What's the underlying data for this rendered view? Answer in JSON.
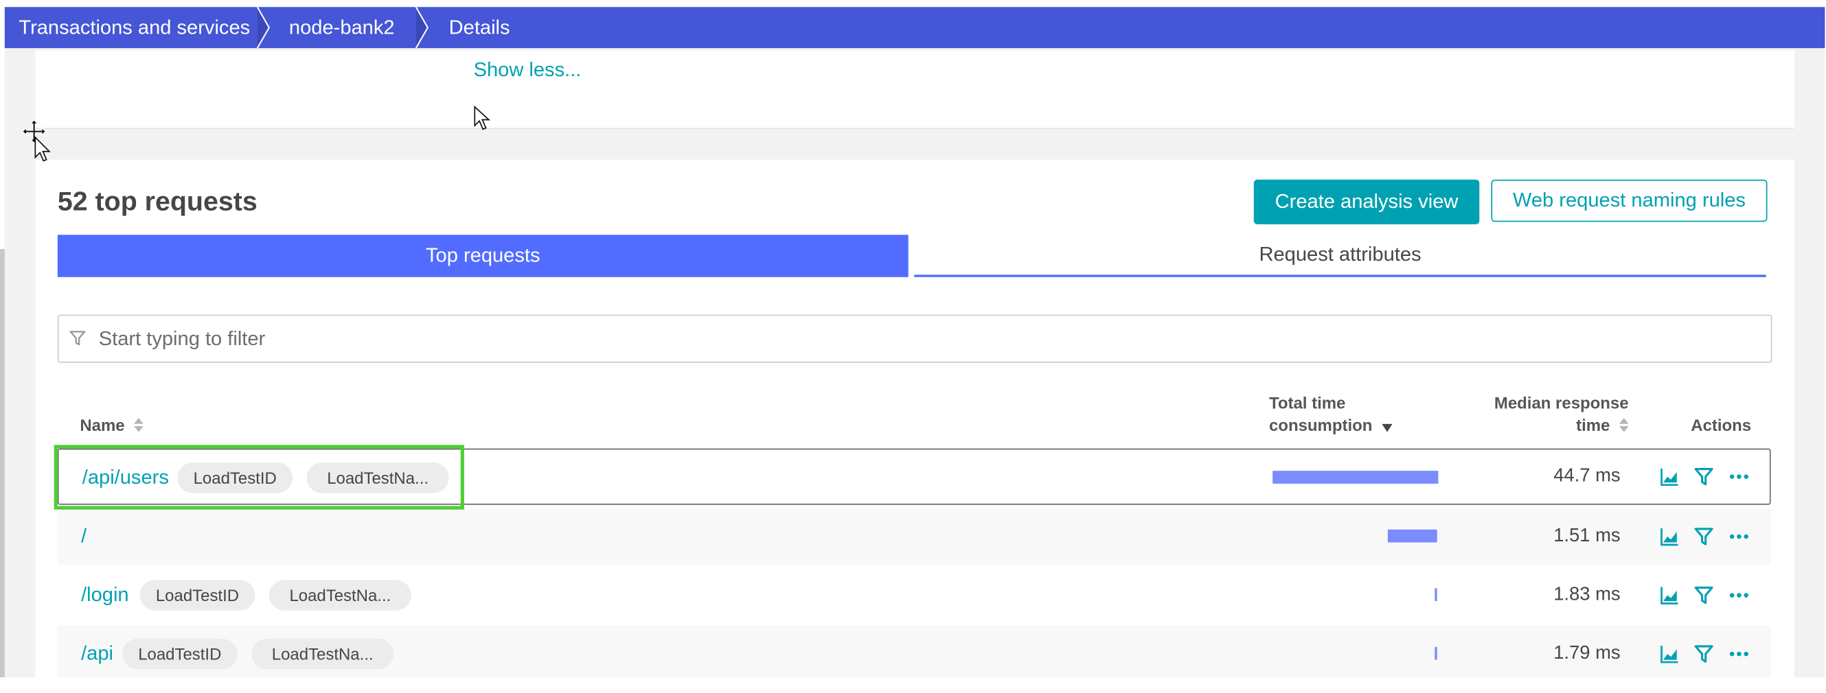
{
  "breadcrumb": {
    "items": [
      {
        "label": "Transactions and services"
      },
      {
        "label": "node-bank2"
      },
      {
        "label": "Details"
      }
    ]
  },
  "top_card": {
    "show_less": "Show less..."
  },
  "requests": {
    "title": "52 top requests",
    "create_analysis_label": "Create analysis view",
    "naming_rules_label": "Web request naming rules",
    "tabs": [
      {
        "label": "Top requests",
        "active": true
      },
      {
        "label": "Request attributes",
        "active": false
      }
    ],
    "filter_placeholder": "Start typing to filter",
    "columns": {
      "name": "Name",
      "total_line1": "Total time",
      "total_line2": "consumption",
      "median_line1": "Median response",
      "median_line2": "time",
      "actions": "Actions"
    },
    "rows": [
      {
        "name": "/api/users",
        "tags": [
          "LoadTestID",
          "LoadTestNa..."
        ],
        "consumption_share": 1.0,
        "median": "44.7 ms",
        "selected": true
      },
      {
        "name": "/",
        "tags": [],
        "consumption_share": 0.3,
        "median": "1.51 ms",
        "selected": false
      },
      {
        "name": "/login",
        "tags": [
          "LoadTestID",
          "LoadTestNa..."
        ],
        "consumption_share": 0.015,
        "median": "1.83 ms",
        "selected": false
      },
      {
        "name": "/api",
        "tags": [
          "LoadTestID",
          "LoadTestNa..."
        ],
        "consumption_share": 0.012,
        "median": "1.79 ms",
        "selected": false
      }
    ]
  },
  "colors": {
    "breadcrumb_bg": "#4556d7",
    "accent_teal": "#00a1b2",
    "tab_active": "#526cff",
    "bar": "#7b8cff",
    "highlight": "#4ccf33"
  },
  "icons": {
    "filter": "filter-icon",
    "sort": "sort-icon",
    "chart": "chart-icon",
    "funnel": "funnel-icon",
    "more": "more-icon",
    "move_cursor": "move-cursor-icon",
    "pointer": "pointer-cursor-icon"
  }
}
